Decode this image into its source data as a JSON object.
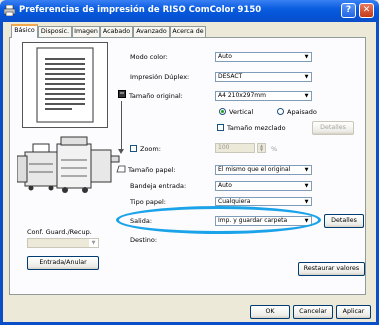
{
  "window": {
    "title": "Preferencias de impresión de RISO ComColor 9150",
    "help_button": "?",
    "close_button": "✕"
  },
  "tabs": [
    "Básico",
    "Disposic.",
    "Imagen",
    "Acabado",
    "Avanzado",
    "Acerca de"
  ],
  "settings": {
    "color_mode": {
      "label": "Modo color:",
      "value": "Auto"
    },
    "duplex": {
      "label": "Impresión Dúplex:",
      "value": "DESACT"
    },
    "original_size": {
      "label": "Tamaño original:",
      "value": "A4 210x297mm"
    },
    "orientation": {
      "vertical_label": "Vertical",
      "landscape_label": "Apaisado",
      "selected": "Vertical"
    },
    "mixed_size": {
      "label": "Tamaño mezclado",
      "checked": false
    },
    "details_disabled_button": "Detalles",
    "zoom": {
      "label": "Zoom:",
      "value": "100",
      "unit": "%",
      "checked": false
    },
    "paper_size": {
      "label": "Tamaño papel:",
      "value": "El mismo que el original"
    },
    "input_tray": {
      "label": "Bandeja entrada:",
      "value": "Auto"
    },
    "paper_type": {
      "label": "Tipo papel:",
      "value": "Cualquiera"
    },
    "output": {
      "label": "Salida:",
      "value": "Imp. y guardar carpeta",
      "details_button": "Detalles"
    },
    "destination": {
      "label": "Destino:"
    }
  },
  "left_panel": {
    "conf_label": "Conf. Guard./Recup.",
    "entry_button": "Entrada/Anular"
  },
  "restore_button": "Restaurar valores",
  "footer": {
    "ok": "OK",
    "cancel": "Cancelar",
    "apply": "Aplicar"
  },
  "colors": {
    "title_bar": "#0a5ce0",
    "highlight": "#1aa3e8",
    "dialog_bg": "#ece9d8"
  }
}
